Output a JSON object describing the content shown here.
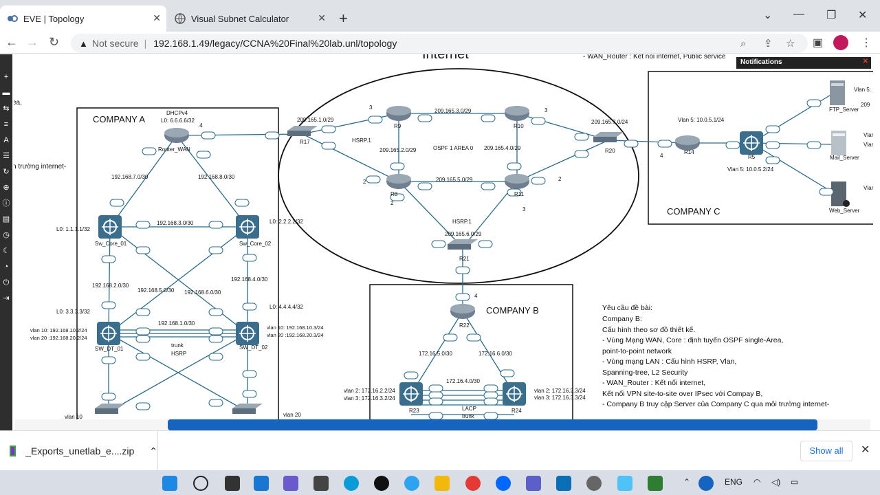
{
  "browser": {
    "tabs": [
      {
        "title": "EVE | Topology",
        "active": true
      },
      {
        "title": "Visual Subnet Calculator",
        "active": false
      }
    ],
    "security_label": "Not secure",
    "url": "192.168.1.49/legacy/CCNA%20Final%20lab.unl/topology"
  },
  "notification": {
    "title": "Notifications"
  },
  "page_text": {
    "internet_title": "Internet",
    "wan_note": "- WAN_Router : Kết nối internet, Public service",
    "left_frag1": "ea,",
    "left_frag2": "n trường internet-"
  },
  "company_a": {
    "label": "COMPANY A",
    "dhcp": "DHCPv4",
    "router_wan_lo": "L0: 6.6.6.6/32",
    "router_wan": "Router_WAN",
    "sw_core_01": "Sw_Core_01",
    "sw_core_02": "Sw_Core_02",
    "sw_dt_01": "SW_DT_01",
    "sw_dt_02": "SW_DT_02",
    "lo_core01": "L0: 1.1.1.1/32",
    "lo_core02": "L0: 2.2.2.2/32",
    "lo_dt01": "L0: 3.3.3.3/32",
    "lo_dt02": "L0: 4.4.4.4/32",
    "net_7": "192.168.7.0/30",
    "net_8": "192.168.8.0/30",
    "net_3": "192.168.3.0/30",
    "net_2": "192.168.2.0/30",
    "net_4": "192.168.4.0/30",
    "net_5": "192.168.5.0/30",
    "net_6": "192.168.6.0/30",
    "net_1": "192.168.1.0/30",
    "vlan10_dt01": "vlan 10: 192.168.10.2/24",
    "vlan20_dt01": "vlan 20 :192.168.20.2/24",
    "vlan10_dt02": "vlan 10: 192.168.10.3/24",
    "vlan20_dt02": "vlan 20 :192.168.20.3/24",
    "trunk": "trunk",
    "hsrp": "HSRP",
    "vlan10": "vlan 10",
    "vlan20": "vlan 20",
    "dot4": ".4"
  },
  "internet": {
    "r17": "R17",
    "r9": "R9",
    "r10": "R10",
    "r8": "R8",
    "r11": "R11",
    "r20": "R20",
    "r21": "R21",
    "net_1": "209.165.1.0/29",
    "net_3": "209.165.3.0/29",
    "net_2": "209.165.2.0/29",
    "net_4": "209.165.4.0/29",
    "net_5": "209.165.5.0/29",
    "net_6": "209.165.6.0/29",
    "net_7": "209.165.7.0/24",
    "ospf": "OSPF 1 AREA 0",
    "hsrp1a": "HSRP.1",
    "hsrp1b": "HSRP.1"
  },
  "company_b": {
    "label": "COMPANY B",
    "r22": "R22",
    "r23": "R23",
    "r24": "R24",
    "net_5": "172.16.5.0/30",
    "net_6": "172.16.6.0/30",
    "net_4": "172.16.4.0/30",
    "vlan2_r23": "vlan 2: 172.16.2.2/24",
    "vlan3_r23": "vlan 3: 172.16.3.2/24",
    "vlan2_r24": "vlan 2: 172.16.2.3/24",
    "vlan3_r24": "vlan 3: 172.16.3.3/24",
    "lacp": "LACP",
    "trunk": "trunk"
  },
  "company_c": {
    "label": "COMPANY C",
    "r14": "R14",
    "r5": "R5",
    "vlan5_r14": "Vlan 5: 10.0.5.1/24",
    "vlan5_r5": "Vlan 5: 10.0.5.2/24",
    "ftp": "FTP_Server",
    "mail": "Mail_Server",
    "web": "Web_Server",
    "vlan5_right": "Vlan 5:",
    "frag_209": "209",
    "frag_vlan": "Vlan"
  },
  "requirements": {
    "lines": [
      "Yêu cầu đề bài:",
      "Company B:",
      "Cấu hình theo sơ đồ thiết kế.",
      "- Vùng Mạng WAN, Core : định tuyến OSPF single-Area,",
      "point-to-point network",
      "- Vùng mạng LAN : Cấu hình HSRP, Vlan,",
      "Spanning-tree, L2 Security",
      "- WAN_Router : Kết nối internet,",
      "Kết nối VPN site-to-site over IPsec với Compay B,",
      "- Company B truy cập Server của Company C qua môi trường internet-"
    ]
  },
  "downloads": {
    "file": "_Exports_unetlab_e....zip",
    "show_all": "Show all"
  },
  "taskbar": {
    "lang": "ENG"
  }
}
